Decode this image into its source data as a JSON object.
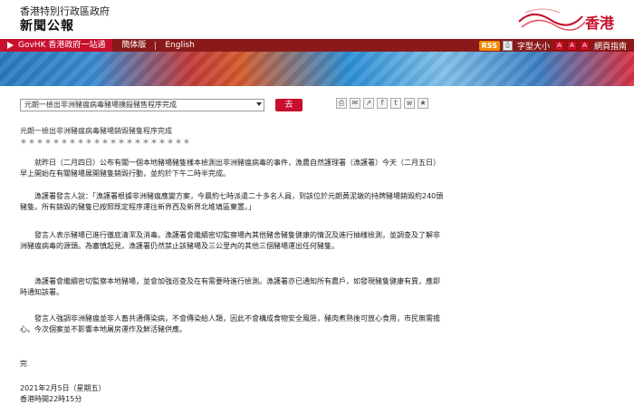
{
  "header": {
    "gov_name": "香港特別行政區政府",
    "site_title": "新聞公報",
    "logo_text": "香港"
  },
  "nav": {
    "govhk": "GovHK 香港政府一站通",
    "simplified": "簡体版",
    "english": "English",
    "rss": "RSS",
    "font_size_label": "字型大小",
    "mobile_label": "網頁指南"
  },
  "toolbar": {
    "select_value": "元朗一檢出非洲豬瘟病毒豬場撲殺豬售程序完成",
    "go_label": "去"
  },
  "article": {
    "headline": "元朗一檢出非洲豬瘟病毒豬場銷毀豬隻程序完成",
    "stars": "＊＊＊＊＊＊＊＊＊＊＊＊＊＊＊＊＊＊＊＊＊",
    "p1": "　　就昨日（二月四日）公布有關一個本地豬場豬隻樣本檢測出非洲豬瘟病毒的事件，漁農自然護理署（漁護署）今天（二月五日）早上開始在有關豬場展開豬隻銷毀行動，並約於下午二時半完成。",
    "p2": "　　漁護署發言人說：「漁護署根據非洲豬瘟應變方案，今晨約七時派遣二十多名人員，到該位於元朗黃泥墩的持牌豬場銷毀約240頭豬隻。所有銷毀的豬隻已按照既定程序運往新界西及新界北堆填區棄置。」",
    "p3": "　　發言人表示豬場已進行徹底清潔及消毒。漁護署會繼續密切監察場內其他豬舍豬隻健康的情況及進行抽樣檢測，並調查及了解非洲豬瘟病毒的源頭。為審慎起見，漁護署仍然禁止該豬場及三公里內的其他三個豬場運出任何豬隻。",
    "p4": "　　漁護署會繼續密切監察本地豬場，並會加強巡查及在有需要時進行檢測。漁護署亦已通知所有農戶，如發現豬隻健康有異，應即時通知該署。",
    "p5": "　　發言人強調非洲豬瘟並非人畜共通傳染病，不會傳染給人類，因此不會構成食物安全風險，豬肉煮熟後可放心食用，市民無需擔心。今次個案並不影響本地屠房運作及鮮活豬供應。",
    "end": "完",
    "date": "2021年2月5日（星期五）",
    "time": "香港時間22時15分"
  },
  "colors": {
    "brand_red": "#c8102e",
    "nav_dark_red": "#8a1a1a"
  }
}
